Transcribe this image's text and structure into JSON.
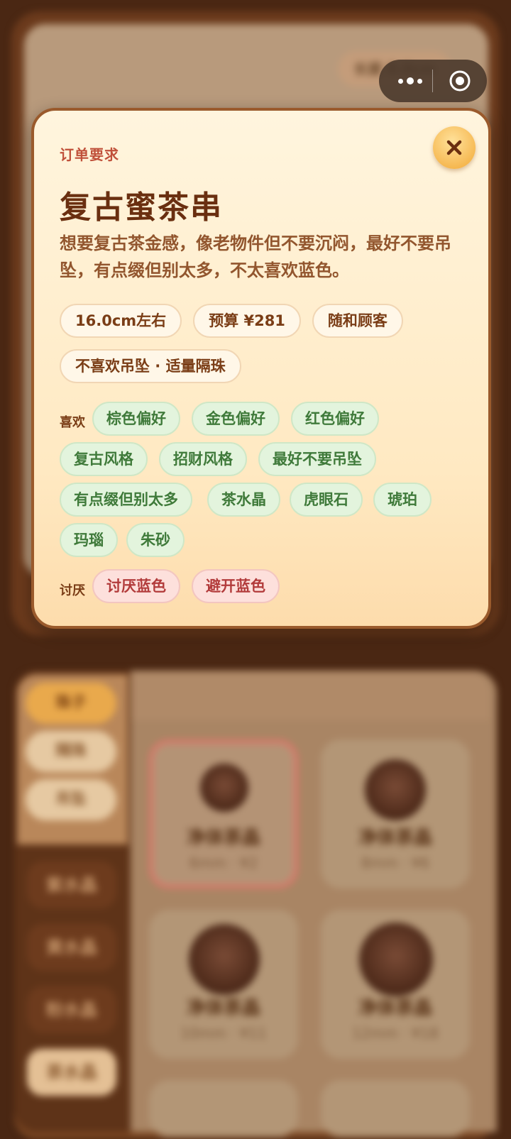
{
  "background": {
    "top_pill": "长度 0.0cm",
    "side_tabs": [
      "珠子",
      "隔珠",
      "吊坠"
    ],
    "side_items": [
      "紫水晶",
      "黄水晶",
      "粉水晶",
      "茶水晶"
    ],
    "products": [
      {
        "name": "净体茶晶",
        "sub": "6mm · ¥2"
      },
      {
        "name": "净体茶晶",
        "sub": "8mm · ¥6"
      },
      {
        "name": "净体茶晶",
        "sub": "10mm · ¥11"
      },
      {
        "name": "净体茶晶",
        "sub": "12mm · ¥18"
      }
    ]
  },
  "modal": {
    "eyebrow": "订单要求",
    "title": "复古蜜茶串",
    "description": "想要复古茶金感，像老物件但不要沉闷，最好不要吊坠，有点缀但别太多，不太喜欢蓝色。",
    "close_icon": "close-icon",
    "chips_row1": [
      "16.0cm左右",
      "预算 ¥281",
      "随和顾客"
    ],
    "chips_row2": [
      "不喜欢吊坠 · 适量隔珠"
    ],
    "likes_label": "喜欢",
    "likes": [
      "棕色偏好",
      "金色偏好",
      "红色偏好",
      "复古风格",
      "招财风格",
      "最好不要吊坠",
      "有点缀但别太多",
      "茶水晶",
      "虎眼石",
      "琥珀",
      "玛瑙",
      "朱砂"
    ],
    "dislikes_label": "讨厌",
    "dislikes": [
      "讨厌蓝色",
      "避开蓝色"
    ]
  },
  "colors": {
    "like_bg": "#e3f4dd",
    "like_text": "#3f7a3a",
    "dislike_bg": "#fde0dc",
    "dislike_text": "#b23b3b",
    "title": "#6a2f10",
    "eyebrow": "#c0503a"
  }
}
